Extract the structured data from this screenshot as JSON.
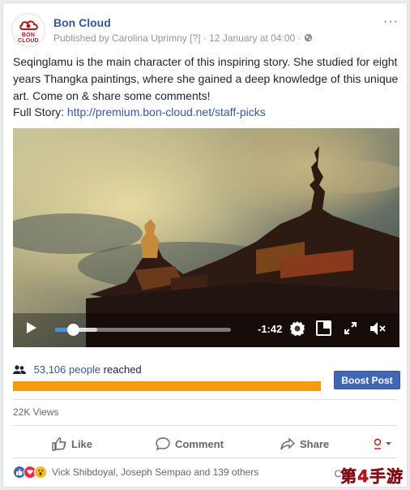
{
  "post": {
    "page_name": "Bon Cloud",
    "logo_text": "BON\nCLOUD",
    "published_by": "Published by Carolina Uprimny",
    "help_marker": "[?]",
    "date": "12 January at 04:00",
    "separator": "·",
    "more": "···",
    "text": "Seqinglamu is the main character of this inspiring story. She studied for eight years Thangka paintings, where she gained a deep knowledge of this unique art. Come on & share some comments!",
    "full_story_label": "Full Story:",
    "full_story_link": "http://premium.bon-cloud.net/staff-picks"
  },
  "video": {
    "time_remaining": "-1:42",
    "progress_fraction": 0.1,
    "buffered_fraction": 0.24
  },
  "insights": {
    "reach_count": "53,106 people",
    "reach_suffix": "reached",
    "reach_bar_fraction": 1.0,
    "boost_label": "Boost Post",
    "views": "22K Views"
  },
  "actions": {
    "like": "Like",
    "comment": "Comment",
    "share": "Share"
  },
  "reactions": {
    "names": "Vick Shibdoyal, Joseph Sempao and 139 others",
    "recent": "Chr"
  },
  "watermark": "第4手游",
  "colors": {
    "link": "#365899",
    "boost": "#4267b2",
    "reach_bar": "#f39c12",
    "progress": "#4a90e2"
  }
}
